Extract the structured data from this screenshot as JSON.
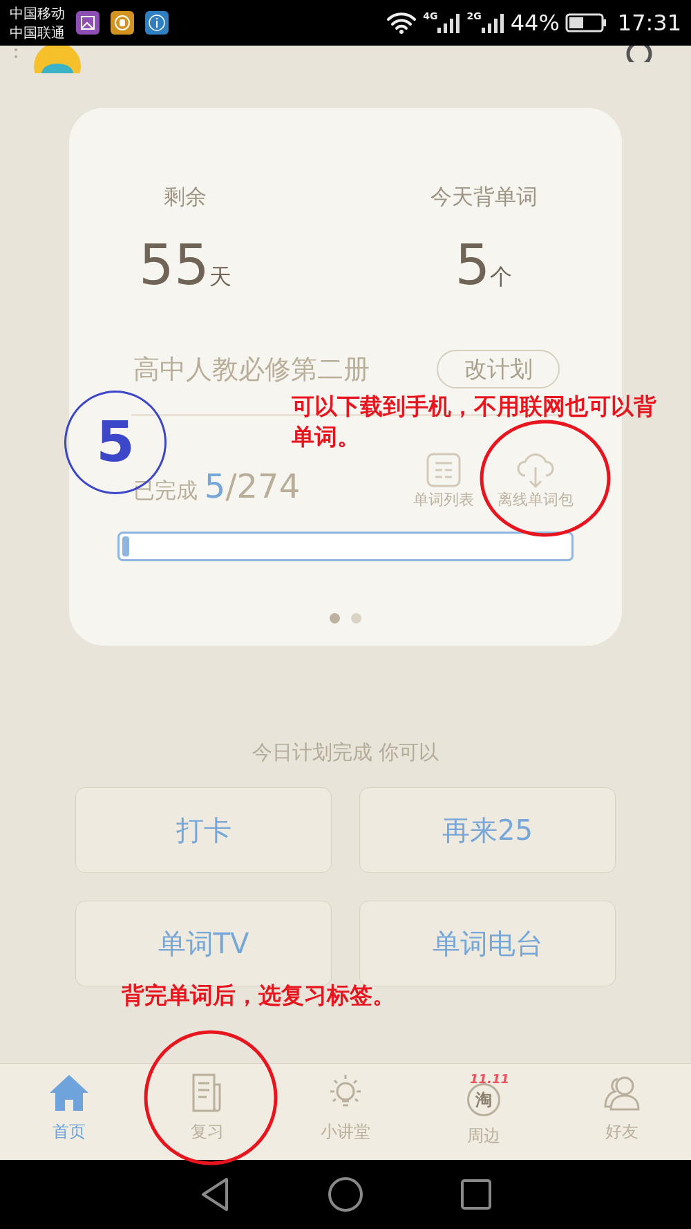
{
  "status_bar": {
    "carriers": [
      "中国移动",
      "中国联通"
    ],
    "networks": [
      "4G",
      "2G"
    ],
    "battery": "44%",
    "time": "17:31"
  },
  "plan_card": {
    "stats": [
      {
        "label": "剩余",
        "value": "55",
        "unit": "天"
      },
      {
        "label": "今天背单词",
        "value": "5",
        "unit": "个"
      }
    ],
    "book": "高中人教必修第二册",
    "change_button": "改计划",
    "done_label": "已完成",
    "done": "5",
    "total": "/274",
    "tools": [
      {
        "label": "单词列表",
        "kind": "list"
      },
      {
        "label": "离线单词包",
        "kind": "download"
      }
    ],
    "progress": {
      "level": 0.01
    },
    "pager": [
      {
        "selected": true
      },
      {
        "selected": false
      }
    ]
  },
  "done_prompt": "今日计划完成 你可以",
  "actions": [
    "打卡",
    "再来25",
    "单词TV",
    "单词电台"
  ],
  "tabs": [
    {
      "label": "首页",
      "kind": "home",
      "selected": true
    },
    {
      "label": "复习",
      "kind": "review",
      "selected": false
    },
    {
      "label": "小讲堂",
      "kind": "bulb",
      "selected": false
    },
    {
      "label": "周边",
      "kind": "shop",
      "selected": false,
      "badge": "11.11",
      "icon_text": "淘"
    },
    {
      "label": "好友",
      "kind": "friends",
      "selected": false
    }
  ],
  "annotations": [
    {
      "kind": "circled-number",
      "text": "5",
      "color": "#3c46c8"
    },
    {
      "kind": "note",
      "text": "可以下载到手机，不用联网也可以背单词。",
      "color": "#e8141e"
    },
    {
      "kind": "ellipse",
      "color": "#e8141e"
    },
    {
      "kind": "note",
      "text": "背完单词后，选复习标签。",
      "color": "#e8141e"
    },
    {
      "kind": "ellipse",
      "color": "#e8141e"
    }
  ]
}
